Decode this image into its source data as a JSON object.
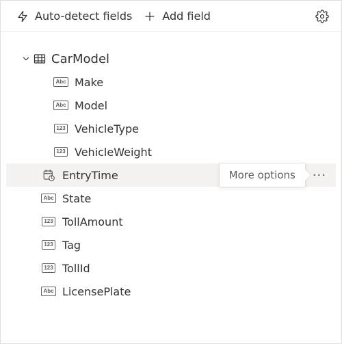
{
  "toolbar": {
    "autoDetect": "Auto-detect fields",
    "addField": "Add field"
  },
  "tooltip": "More options",
  "entity": {
    "name": "CarModel",
    "fields": [
      {
        "label": "Make",
        "type": "abc",
        "indent": 2,
        "hover": false
      },
      {
        "label": "Model",
        "type": "abc",
        "indent": 2,
        "hover": false
      },
      {
        "label": "VehicleType",
        "type": "num",
        "indent": 2,
        "hover": false
      },
      {
        "label": "VehicleWeight",
        "type": "num",
        "indent": 2,
        "hover": false
      },
      {
        "label": "EntryTime",
        "type": "date",
        "indent": 1,
        "hover": true
      },
      {
        "label": "State",
        "type": "abc",
        "indent": 1,
        "hover": false
      },
      {
        "label": "TollAmount",
        "type": "num",
        "indent": 1,
        "hover": false
      },
      {
        "label": "Tag",
        "type": "num",
        "indent": 1,
        "hover": false
      },
      {
        "label": "TollId",
        "type": "num",
        "indent": 1,
        "hover": false
      },
      {
        "label": "LicensePlate",
        "type": "abc",
        "indent": 1,
        "hover": false
      }
    ]
  },
  "badges": {
    "abc": "Abc",
    "num": "123"
  }
}
